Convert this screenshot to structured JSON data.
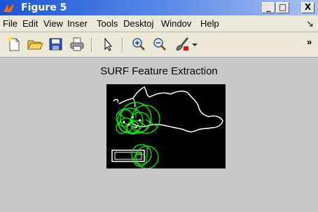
{
  "window": {
    "title": "Figure 5"
  },
  "menu": {
    "items": [
      "File",
      "Edit",
      "View",
      "Inser",
      "Tools",
      "Desktoj",
      "Windov",
      "Help",
      "↘"
    ]
  },
  "toolbar": {
    "overflow": "»",
    "tools": [
      "new-figure-icon",
      "open-file-icon",
      "save-icon",
      "print-icon",
      "edit-plot-arrow-icon",
      "zoom-in-icon",
      "zoom-out-icon",
      "data-brush-icon"
    ]
  },
  "figure": {
    "title": "SURF Feature Extraction",
    "feature_color": "#00ff00",
    "outline_color": "#ffffff"
  },
  "controls": {
    "minimize": "_",
    "maximize": "□",
    "close": "X"
  }
}
